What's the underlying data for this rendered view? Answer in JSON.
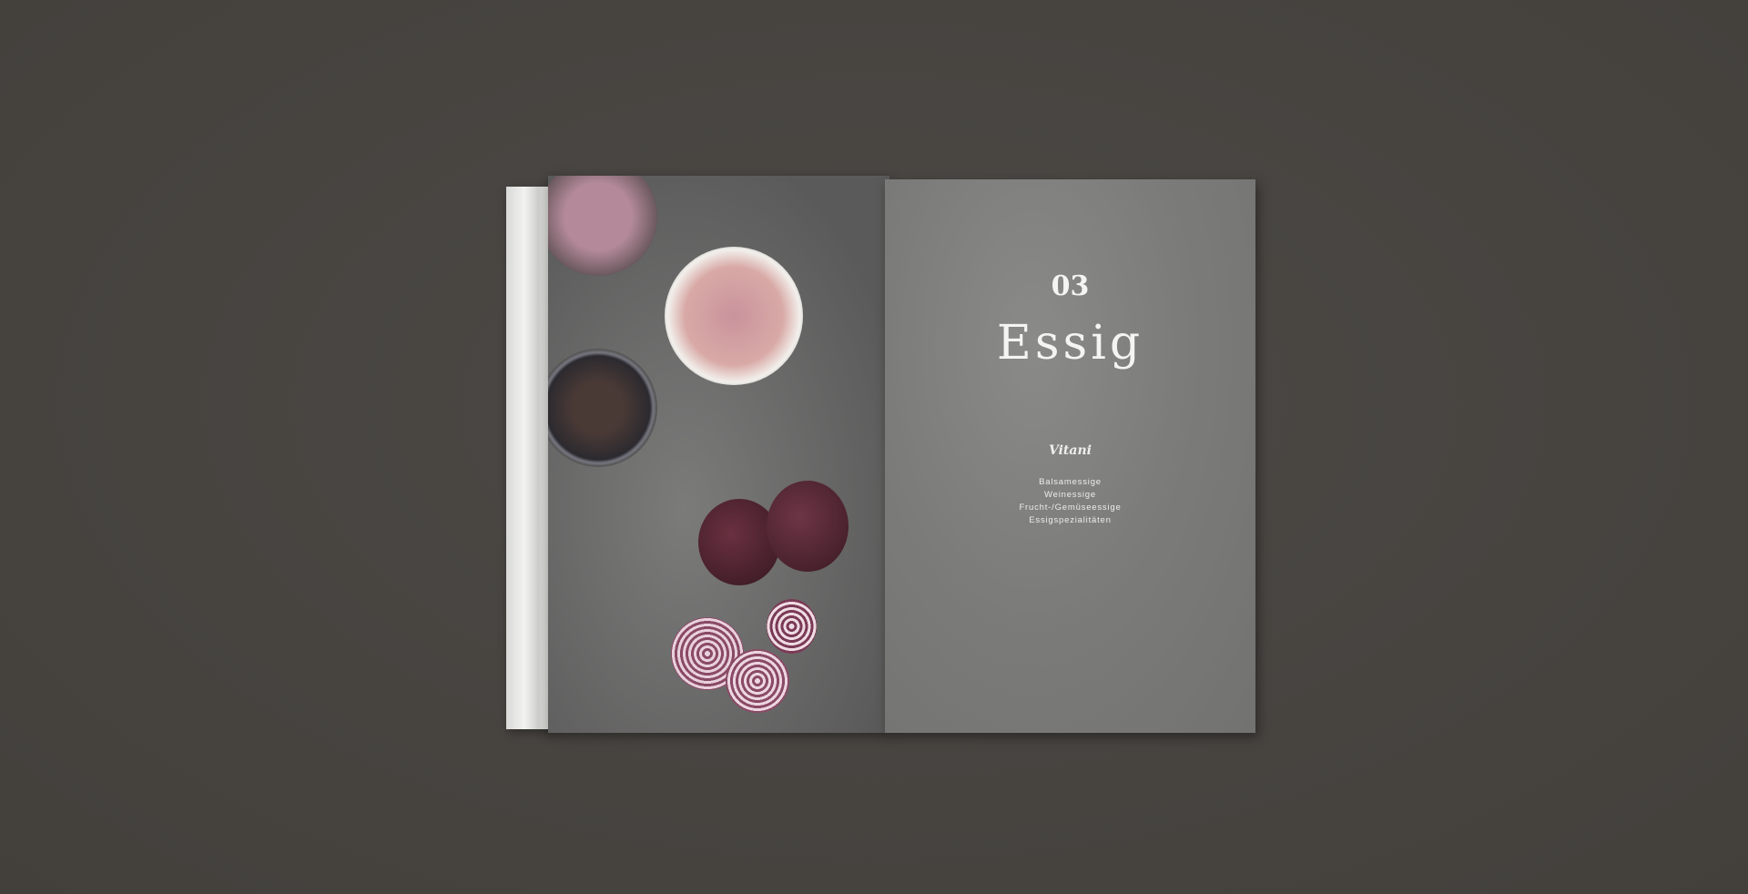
{
  "photo": {
    "subject": "open cookbook with pickled red onions"
  },
  "right_page": {
    "chapter_number": "03",
    "chapter_title": "Essig",
    "logo_text": "Vitani",
    "items": [
      "Balsamessige",
      "Weinessige",
      "Frucht-/Gemüseessige",
      "Essigspezialitäten"
    ]
  },
  "colors": {
    "background": "#484542",
    "page": "#808080",
    "text": "#f4f4f2"
  }
}
